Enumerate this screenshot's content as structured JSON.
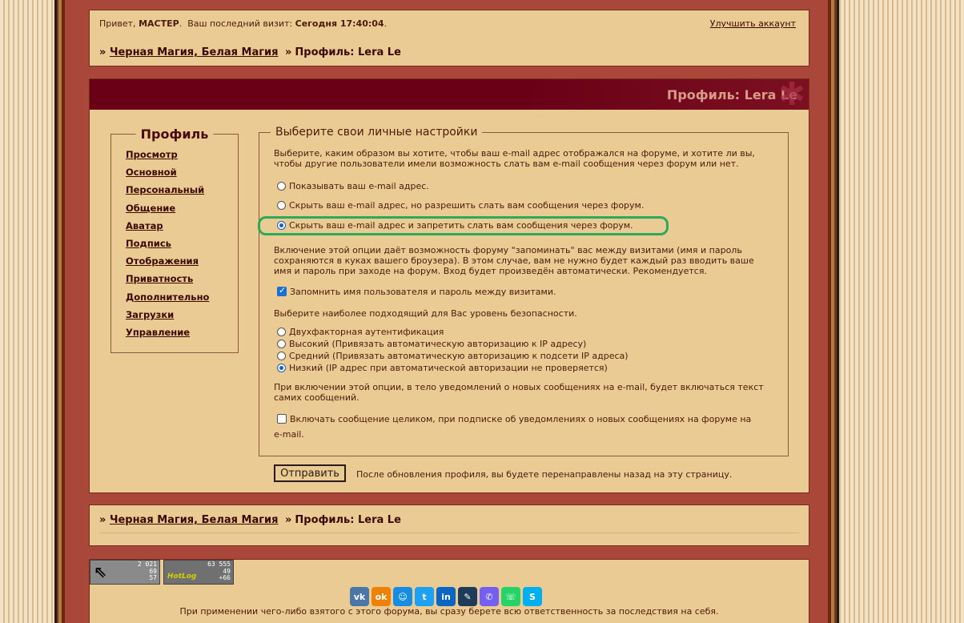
{
  "top": {
    "greeting_prefix": "Привет,",
    "username": "МАСТЕР",
    "greeting_dot": ".",
    "last_visit_label": "Ваш последний визит:",
    "last_visit_value": "Сегодня 17:40:04",
    "last_visit_dot": ".",
    "upgrade_link": "Улучшить аккаунт"
  },
  "breadcrumb": {
    "sep": "»",
    "forum": "Черная Магия, Белая Магия",
    "page": "Профиль: Lera Le"
  },
  "profile": {
    "header_title": "Профиль: Lera Le",
    "nav_title": "Профиль",
    "nav_items": [
      "Просмотр",
      "Основной",
      "Персональный",
      "Общение",
      "Аватар",
      "Подпись",
      "Отображения",
      "Приватность",
      "Дополнительно",
      "Загрузки",
      "Управление"
    ]
  },
  "settings": {
    "legend": "Выберите свои личные настройки",
    "email_desc": "Выберите, каким образом вы хотите, чтобы ваш e-mail адрес отображался на форуме, и хотите ли вы, чтобы другие пользователи имели возможность слать вам e-mail сообщения через форум или нет.",
    "email_options": [
      "Показывать ваш e-mail адрес.",
      "Скрыть ваш e-mail адрес, но разрешить слать вам сообщения через форум.",
      "Скрыть ваш e-mail адрес и запретить слать вам сообщения через форум."
    ],
    "email_selected": 2,
    "remember_desc": "Включение этой опции даёт возможность форуму \"запоминать\" вас между визитами (имя и пароль сохраняются в куках вашего броузера). В этом случае, вам не нужно будет каждый раз вводить ваше имя и пароль при заходе на форум. Вход будет произведён автоматически. Рекомендуется.",
    "remember_label": "Запомнить имя пользователя и пароль между визитами.",
    "remember_checked": true,
    "security_desc": "Выберите наиболее подходящий для Вас уровень безопасности.",
    "security_options": [
      "Двухфакторная аутентификация",
      "Высокий (Привязать автоматическую авторизацию к IP адресу)",
      "Средний (Привязать автоматическую авторизацию к подсети IP адреса)",
      "Низкий (IP адрес при автоматической авторизации не проверяется)"
    ],
    "security_selected": 3,
    "fulltext_desc": "При включении этой опции, в тело уведомлений о новых сообщениях на e-mail, будет включаться текст самих сообщений.",
    "fulltext_label_1": "Включать сообщение целиком, при подписке об уведомлениях о новых сообщениях на форуме на",
    "fulltext_label_2": "e-mail.",
    "fulltext_checked": false
  },
  "actions": {
    "submit": "Отправить",
    "submit_note": "После обновления профиля, вы будете перенаправлены назад на эту страницу."
  },
  "footer": {
    "counter1_lines": [
      "2 021",
      "69",
      "57"
    ],
    "counter2_logo": "HotLog",
    "counter2_lines": [
      "63 555",
      "49",
      "+66"
    ],
    "share": [
      {
        "icon": "vk-icon",
        "glyph": "vk",
        "color": "#4a76a8"
      },
      {
        "icon": "odnoklassniki-icon",
        "glyph": "ok",
        "color": "#ee8208"
      },
      {
        "icon": "moimir-icon",
        "glyph": "☺",
        "color": "#168de2"
      },
      {
        "icon": "twitter-icon",
        "glyph": "t",
        "color": "#1da1f2"
      },
      {
        "icon": "linkedin-icon",
        "glyph": "in",
        "color": "#0a66c2"
      },
      {
        "icon": "livejournal-icon",
        "glyph": "✎",
        "color": "#1f3b57"
      },
      {
        "icon": "viber-icon",
        "glyph": "✆",
        "color": "#7360f2"
      },
      {
        "icon": "whatsapp-icon",
        "glyph": "☏",
        "color": "#25d366"
      },
      {
        "icon": "skype-icon",
        "glyph": "S",
        "color": "#00aff0"
      }
    ],
    "disclaimer": "При применении чего-либо взятого с этого форума, вы сразу берете всю ответственность за последствия на себя."
  },
  "colors": {
    "highlight": "#2aaa5a",
    "header_bg": "#6a0016",
    "panel_bg": "#ebcb94"
  }
}
